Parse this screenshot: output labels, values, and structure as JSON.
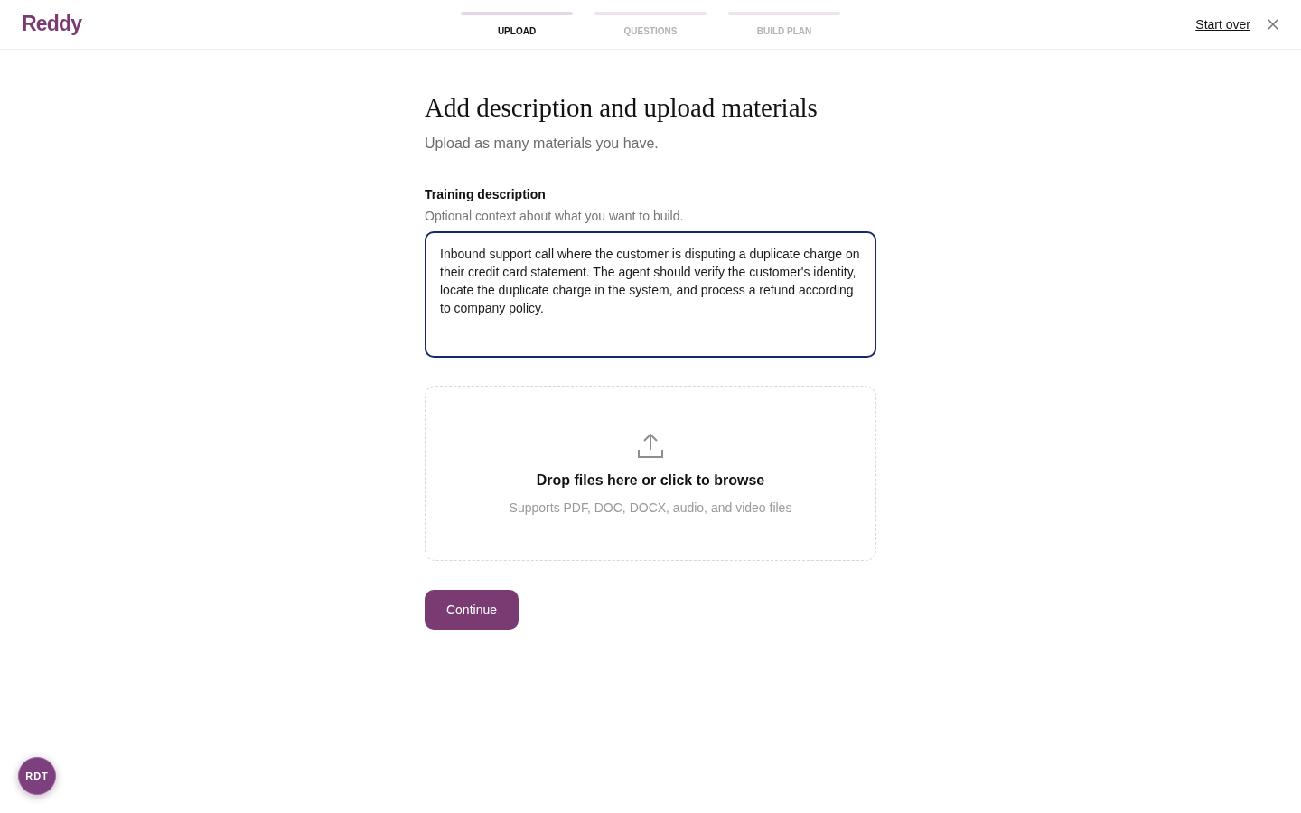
{
  "header": {
    "logo": "Reddy",
    "steps": [
      {
        "label": "UPLOAD",
        "selected": true
      },
      {
        "label": "QUESTIONS",
        "selected": false
      },
      {
        "label": "BUILD PLAN",
        "selected": false
      }
    ],
    "start_over": "Start over"
  },
  "page": {
    "title": "Add description and upload materials",
    "subtitle": "Upload as many materials you have."
  },
  "description": {
    "label": "Training description",
    "hint": "Optional context about what you want to build.",
    "value": "Inbound support call where the customer is disputing a duplicate charge on their credit card statement. The agent should verify the customer's identity, locate the duplicate charge in the system, and process a refund according to company policy.",
    "focused": true
  },
  "dropzone": {
    "title": "Drop files here or click to browse",
    "subtitle": "Supports PDF, DOC, DOCX, audio, and video files"
  },
  "continue_button": "Continue",
  "user_avatar": "RDT"
}
